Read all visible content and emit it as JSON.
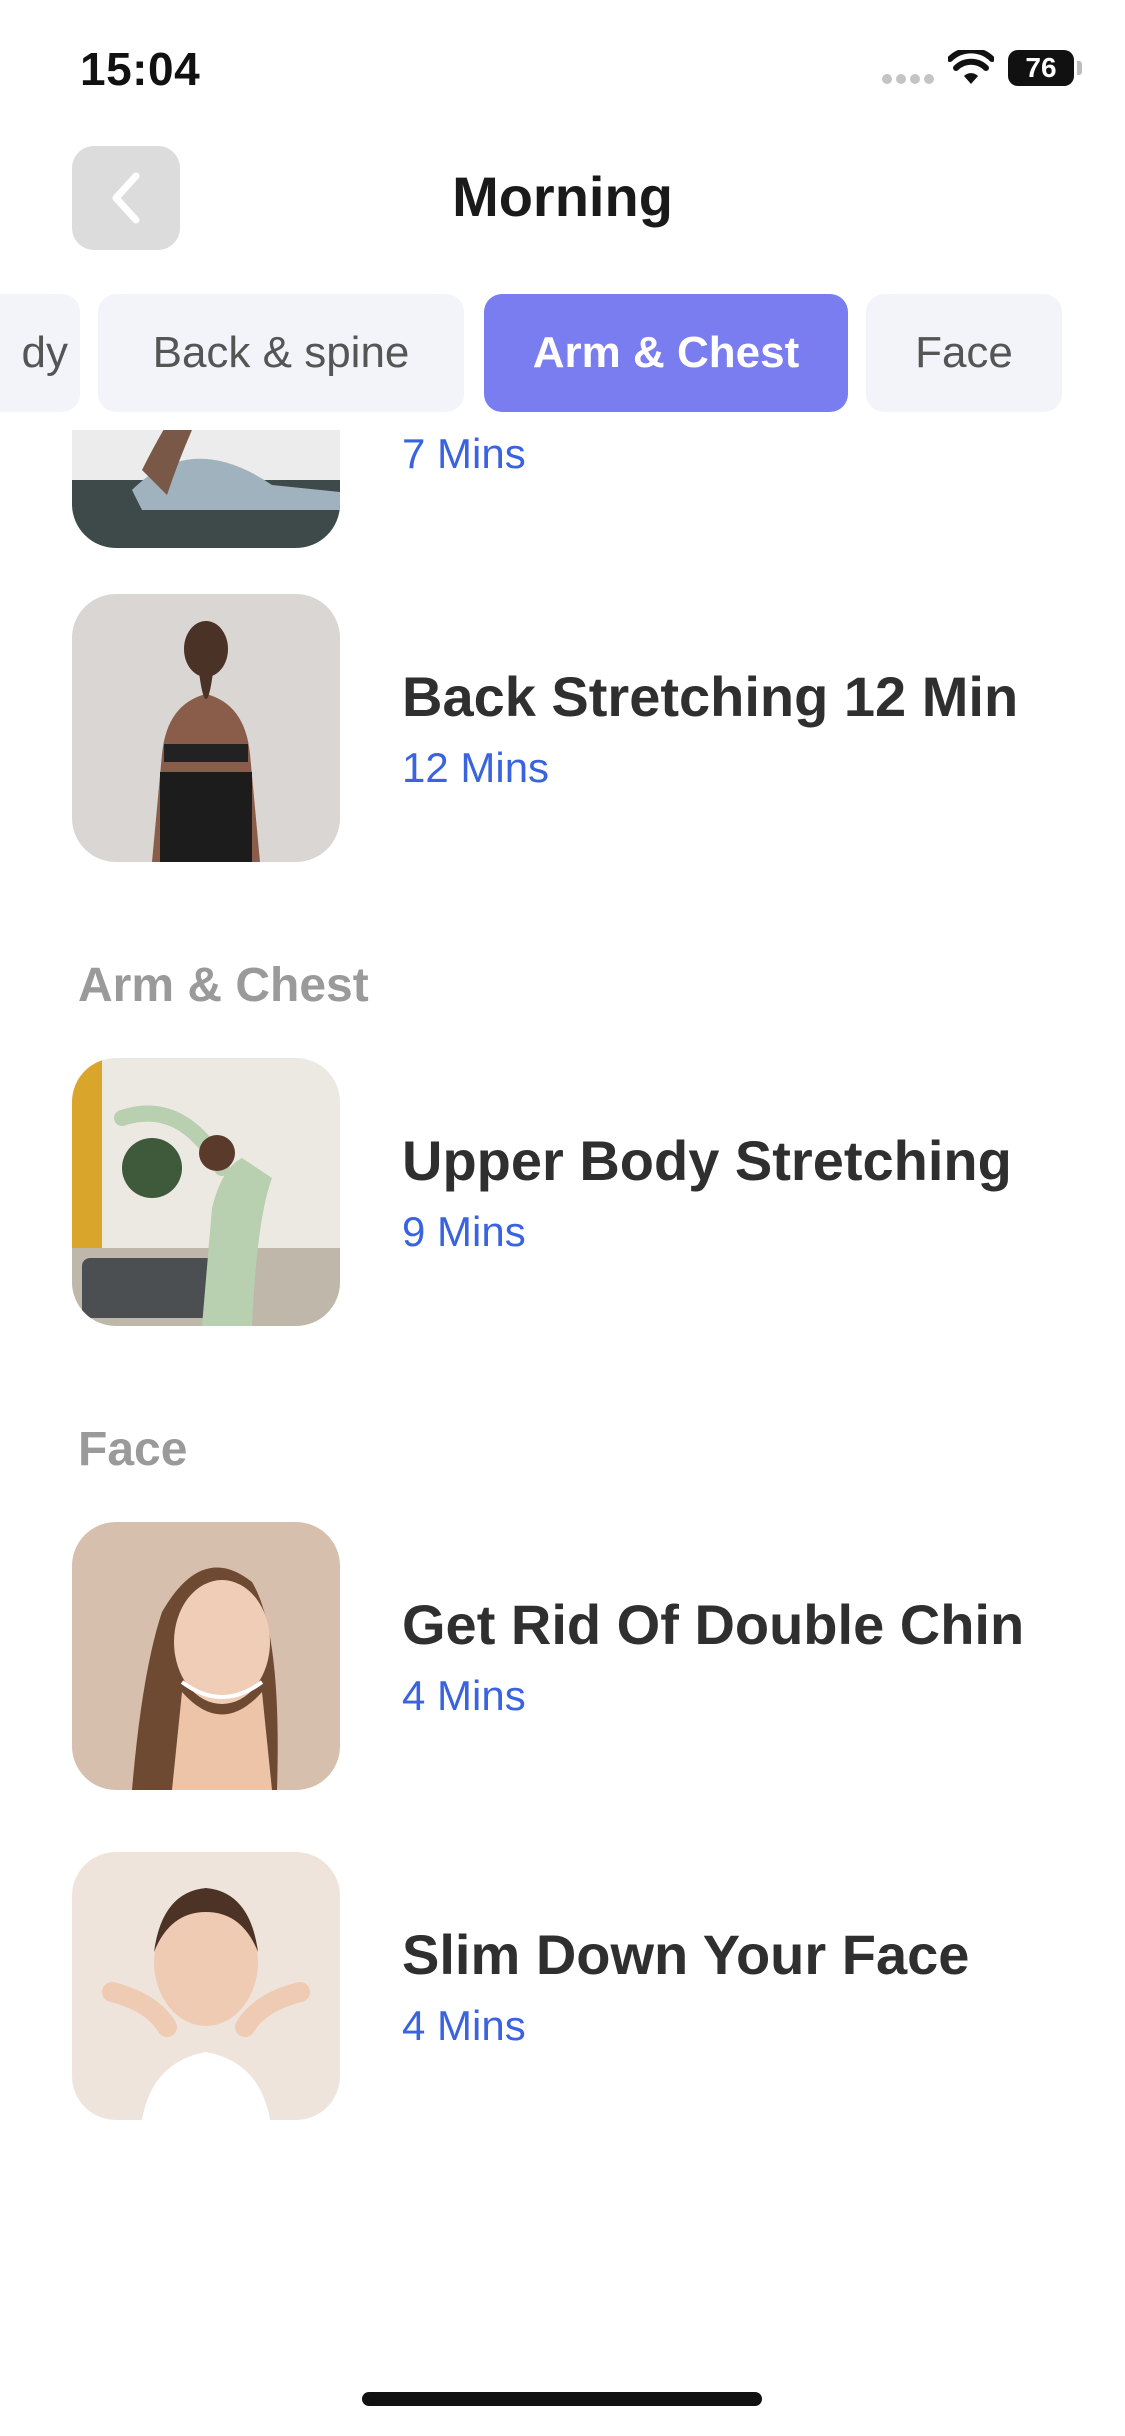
{
  "status_bar": {
    "time": "15:04",
    "battery": "76"
  },
  "header": {
    "title": "Morning",
    "back_icon": "chevron-left-icon"
  },
  "tabs": [
    {
      "label": "dy",
      "active": false
    },
    {
      "label": "Back & spine",
      "active": false
    },
    {
      "label": "Arm & Chest",
      "active": true
    },
    {
      "label": "Face",
      "active": false
    }
  ],
  "list": {
    "partial_item": {
      "duration": "7 Mins"
    },
    "back_stretching": {
      "title": "Back Stretching 12 Min",
      "duration": "12 Mins"
    },
    "arm_chest_section": {
      "heading": "Arm & Chest",
      "items": [
        {
          "title": "Upper Body Stretching",
          "duration": "9 Mins"
        }
      ]
    },
    "face_section": {
      "heading": "Face",
      "items": [
        {
          "title": "Get Rid Of Double Chin",
          "duration": "4 Mins"
        },
        {
          "title": "Slim Down Your Face",
          "duration": "4 Mins"
        }
      ]
    }
  },
  "colors": {
    "accent": "#7a7df0",
    "duration_blue": "#3a63e0",
    "tab_bg": "#f3f4f9",
    "section_gray": "#9a9a9a"
  }
}
